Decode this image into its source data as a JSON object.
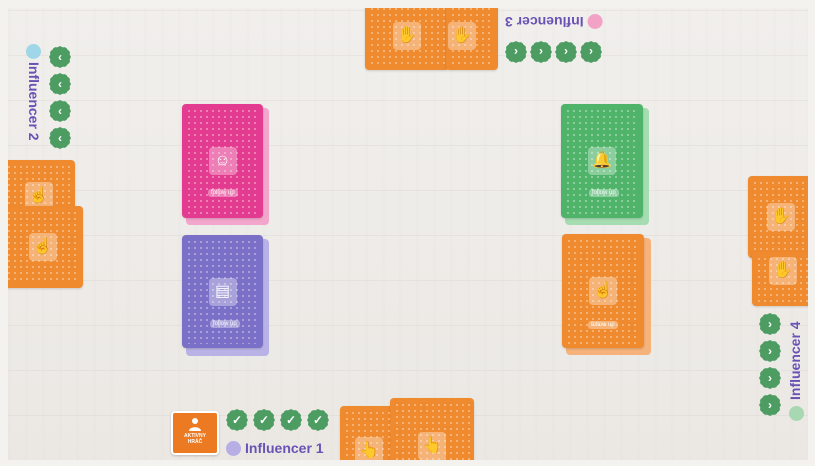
{
  "players": {
    "p1": {
      "name": "Influencer 1",
      "avatar_color": "#b7aee3",
      "chips": [
        "✓",
        "✓",
        "✓",
        "✓"
      ]
    },
    "p2": {
      "name": "Influencer 2",
      "avatar_color": "#9fd6e8",
      "chips": [
        "‹",
        "‹",
        "‹",
        "‹"
      ]
    },
    "p3": {
      "name": "Influencer 3",
      "avatar_color": "#f2a3c5",
      "chips": [
        "‹",
        "‹",
        "‹",
        "‹"
      ]
    },
    "p4": {
      "name": "Influencer 4",
      "avatar_color": "#a8d8b2",
      "chips": [
        "›",
        "›",
        "›",
        "›"
      ]
    }
  },
  "active_badge": {
    "line1": "AKTIVNY",
    "line2": "HRÁČ"
  },
  "decks": {
    "pink": {
      "icon": "profile-icon",
      "tag": "follow up",
      "color": "#e33b8f"
    },
    "purple": {
      "icon": "news-icon",
      "tag": "follow up",
      "color": "#7a70c8"
    },
    "green": {
      "icon": "bell-icon",
      "tag": "follow up",
      "color": "#4fb36a"
    },
    "orange": {
      "icon": "pointer-hand-icon",
      "tag": "follow up",
      "color": "#f08a2e"
    }
  },
  "hand_icons": {
    "p1": "👆",
    "p2": "☝",
    "p3": "👎",
    "p4": "👎"
  }
}
